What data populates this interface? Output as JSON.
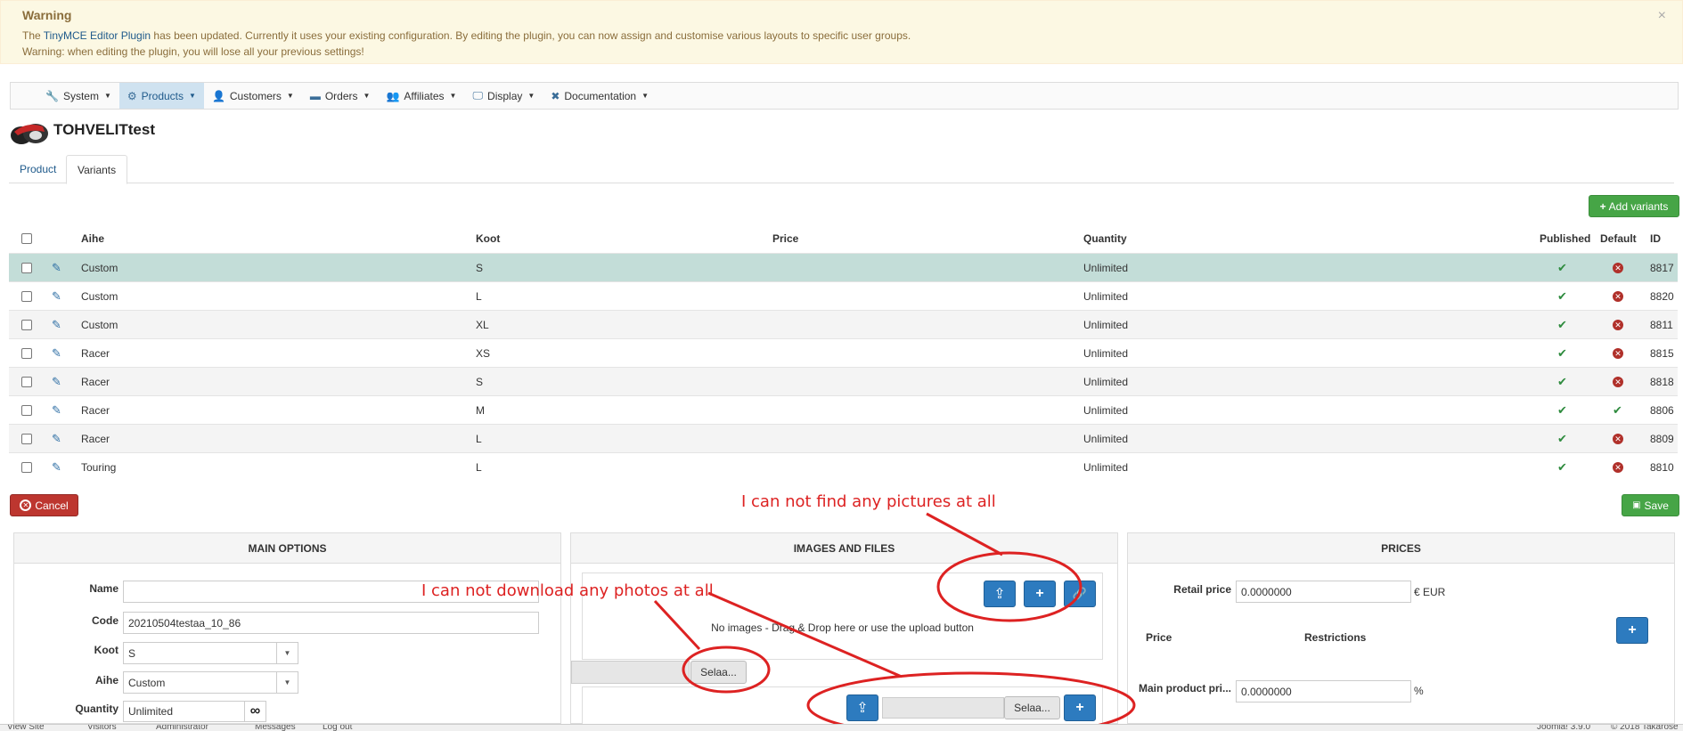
{
  "warning": {
    "title": "Warning",
    "line1_prefix": "The ",
    "line1_link": "TinyMCE Editor Plugin",
    "line1_suffix": " has been updated. Currently it uses your existing configuration. By editing the plugin, you can now assign and customise various layouts to specific user groups.",
    "line2": "Warning: when editing the plugin, you will lose all your previous settings!",
    "close": "×"
  },
  "menu": [
    {
      "label": "System",
      "icon": "wrench-icon",
      "glyph": "🔧"
    },
    {
      "label": "Products",
      "icon": "cubes-icon",
      "glyph": "⚙"
    },
    {
      "label": "Customers",
      "icon": "user-icon",
      "glyph": "👤"
    },
    {
      "label": "Orders",
      "icon": "credit-card-icon",
      "glyph": "▬"
    },
    {
      "label": "Affiliates",
      "icon": "users-icon",
      "glyph": "👥"
    },
    {
      "label": "Display",
      "icon": "monitor-icon",
      "glyph": "🖵"
    },
    {
      "label": "Documentation",
      "icon": "help-circle-icon",
      "glyph": "✖"
    }
  ],
  "page": {
    "title": "TOHVELITtest"
  },
  "tabs": [
    "Product",
    "Variants"
  ],
  "add_variants": "Add variants",
  "table": {
    "headers": {
      "aihe": "Aihe",
      "koot": "Koot",
      "price": "Price",
      "quantity": "Quantity",
      "published": "Published",
      "default": "Default",
      "id": "ID"
    },
    "rows": [
      {
        "aihe": "Custom",
        "koot": "S",
        "price": "",
        "quantity": "Unlimited",
        "published": true,
        "default": false,
        "id": "8817"
      },
      {
        "aihe": "Custom",
        "koot": "L",
        "price": "",
        "quantity": "Unlimited",
        "published": true,
        "default": false,
        "id": "8820"
      },
      {
        "aihe": "Custom",
        "koot": "XL",
        "price": "",
        "quantity": "Unlimited",
        "published": true,
        "default": false,
        "id": "8811"
      },
      {
        "aihe": "Racer",
        "koot": "XS",
        "price": "",
        "quantity": "Unlimited",
        "published": true,
        "default": false,
        "id": "8815"
      },
      {
        "aihe": "Racer",
        "koot": "S",
        "price": "",
        "quantity": "Unlimited",
        "published": true,
        "default": false,
        "id": "8818"
      },
      {
        "aihe": "Racer",
        "koot": "M",
        "price": "",
        "quantity": "Unlimited",
        "published": true,
        "default": true,
        "id": "8806"
      },
      {
        "aihe": "Racer",
        "koot": "L",
        "price": "",
        "quantity": "Unlimited",
        "published": true,
        "default": false,
        "id": "8809"
      },
      {
        "aihe": "Touring",
        "koot": "L",
        "price": "",
        "quantity": "Unlimited",
        "published": true,
        "default": false,
        "id": "8810"
      }
    ]
  },
  "buttons": {
    "cancel": "Cancel",
    "save": "Save"
  },
  "main_options": {
    "title": "MAIN OPTIONS",
    "name_label": "Name",
    "name_value": "",
    "code_label": "Code",
    "code_value": "20210504testaa_10_86",
    "koot_label": "Koot",
    "koot_value": "S",
    "aihe_label": "Aihe",
    "aihe_value": "Custom",
    "quantity_label": "Quantity",
    "quantity_value": "Unlimited"
  },
  "images": {
    "title": "IMAGES AND FILES",
    "empty_text": "No images - Drag & Drop here or use the upload button",
    "browse": "Selaa..."
  },
  "prices": {
    "title": "PRICES",
    "retail_label": "Retail price",
    "retail_value": "0.0000000",
    "currency": "€ EUR",
    "price_col": "Price",
    "restrictions_col": "Restrictions",
    "main_label": "Main product pri...",
    "main_value": "0.0000000",
    "percent": "%"
  },
  "annotations": {
    "pictures": "I can not find any pictures at all",
    "photos": "I can not download any photos at all"
  },
  "colors": {
    "annotation": "#dd2222",
    "accent": "#2d7bbf",
    "success": "#46a546",
    "danger": "#bd362f"
  },
  "statusbar": {
    "view_site": "View Site",
    "visitors": "Visitors",
    "admins": "Administrator",
    "messages": "Messages",
    "logout": "Log out",
    "version": "Joomla! 3.9.0",
    "copyright": "© 2018 Takarose"
  }
}
